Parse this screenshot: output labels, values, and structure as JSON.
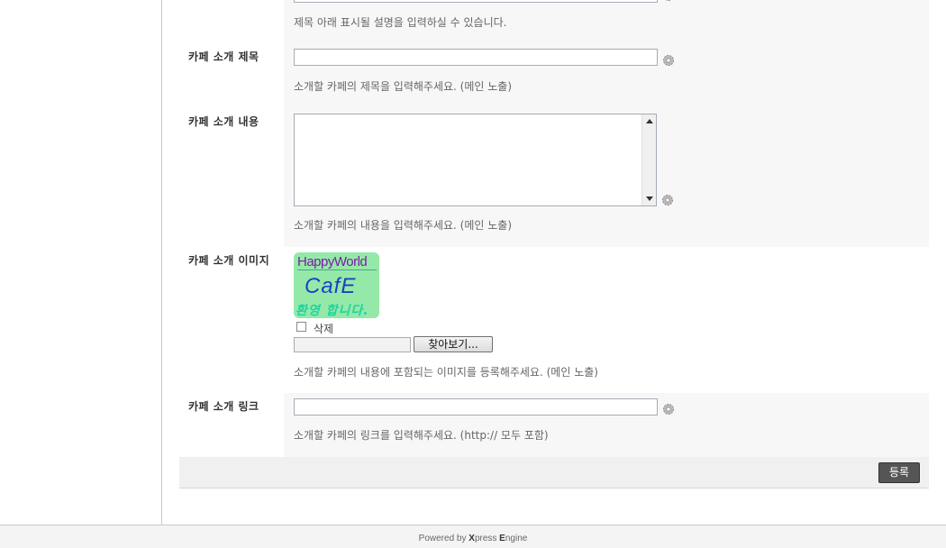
{
  "rows": {
    "subtitle": {
      "desc": "제목 아래 표시될 설명을 입력하실 수 있습니다."
    },
    "intro_title": {
      "label": "카페 소개 제목",
      "value": "",
      "desc": "소개할 카페의 제목을 입력해주세요. (메인 노출)"
    },
    "intro_content": {
      "label": "카페 소개 내용",
      "value": "",
      "desc": "소개할 카페의 내용을 입력해주세요. (메인 노출)"
    },
    "intro_image": {
      "label": "카페 소개 이미지",
      "image_text": {
        "line1": "HappyWorld",
        "line2": "CafE",
        "line3": "환영 합니다."
      },
      "delete_label": "삭제",
      "browse_label": "찾아보기...",
      "desc": "소개할 카페의 내용에 포함되는 이미지를 등록해주세요. (메인 노출)"
    },
    "intro_link": {
      "label": "카페 소개 링크",
      "value": "",
      "desc": "소개할 카페의 링크를 입력해주세요. (http:// 모두 포함)"
    }
  },
  "submit_label": "등록",
  "footer": {
    "prefix": "Powered by ",
    "brand_x": "X",
    "brand_rest": "press ",
    "brand_e": "E",
    "brand_end": "ngine"
  },
  "colors": {
    "row_bg": "#f7f7f7",
    "submit_bg": "#555555",
    "image_bg": "#95e9a8"
  },
  "icons": [
    "gear-icon",
    "scroll-up-icon",
    "scroll-down-icon"
  ]
}
